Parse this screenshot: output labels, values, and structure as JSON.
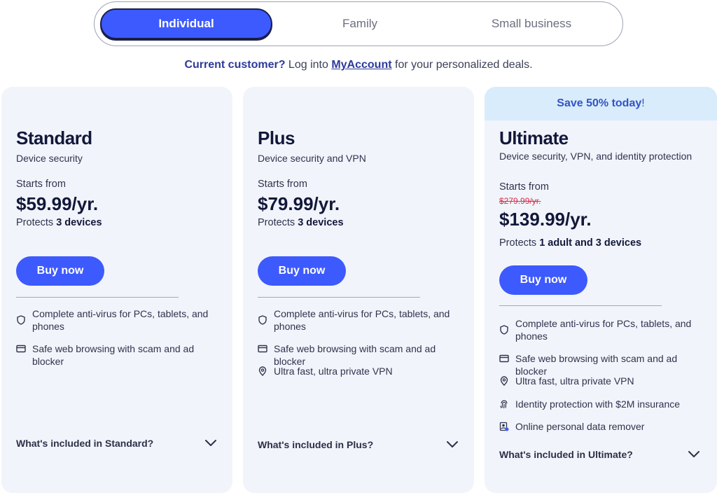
{
  "tabs": [
    {
      "label": "Individual",
      "active": true
    },
    {
      "label": "Family",
      "active": false
    },
    {
      "label": "Small business",
      "active": false
    }
  ],
  "notice": {
    "lead": "Current customer?",
    "pre_link": "Log into",
    "link": "MyAccount",
    "post_link": "for your personalized deals."
  },
  "plans": [
    {
      "name": "Standard",
      "description": "Device security",
      "starts_from": "Starts from",
      "price": "$59.99/yr.",
      "protects_prefix": "Protects",
      "protects_bold": "3 devices",
      "buy_label": "Buy now",
      "features": [
        {
          "icon": "shield-icon",
          "text": "Complete anti-virus for PCs, tablets, and phones"
        },
        {
          "icon": "browser-icon",
          "text": "Safe web browsing with scam and ad blocker"
        }
      ],
      "footer": "What's included in Standard?"
    },
    {
      "name": "Plus",
      "description": "Device security and VPN",
      "starts_from": "Starts from",
      "price": "$79.99/yr.",
      "protects_prefix": "Protects",
      "protects_bold": "3 devices",
      "buy_label": "Buy now",
      "features": [
        {
          "icon": "shield-icon",
          "text": "Complete anti-virus for PCs, tablets, and phones"
        },
        {
          "icon": "browser-icon",
          "text": "Safe web browsing with scam and ad blocker"
        },
        {
          "icon": "location-pin-icon",
          "text": "Ultra fast, ultra private VPN"
        }
      ],
      "footer": "What's included in Plus?"
    },
    {
      "name": "Ultimate",
      "promo": "Save 50% today",
      "promo_suffix": "!",
      "description": "Device security, VPN, and identity protection",
      "starts_from": "Starts from",
      "old_price": "$279.99/yr.",
      "price": "$139.99/yr.",
      "protects_prefix": "Protects",
      "protects_bold": "1 adult and 3 devices",
      "buy_label": "Buy now",
      "features": [
        {
          "icon": "shield-icon",
          "text": "Complete anti-virus for PCs, tablets, and phones"
        },
        {
          "icon": "browser-icon",
          "text": "Safe web browsing with scam and ad blocker"
        },
        {
          "icon": "location-pin-icon",
          "text": "Ultra fast, ultra private VPN"
        },
        {
          "icon": "fingerprint-icon",
          "text": "Identity protection with $2M insurance"
        },
        {
          "icon": "data-remover-icon",
          "text": "Online personal data remover"
        }
      ],
      "footer": "What's included in Ultimate?"
    }
  ],
  "colors": {
    "accent": "#3d5afe",
    "card_bg": "#f2f4fb",
    "promo_bg": "#d8ecfb",
    "strike": "#d0314a"
  }
}
